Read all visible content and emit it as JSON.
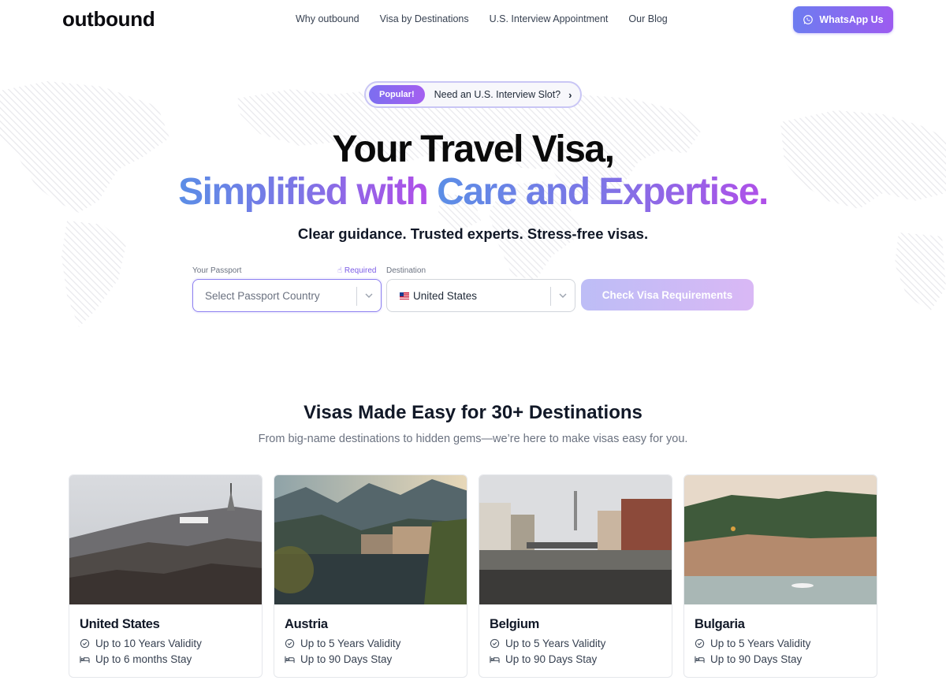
{
  "nav": {
    "logo": "outbound",
    "links": [
      "Why outbound",
      "Visa by Destinations",
      "U.S. Interview Appointment",
      "Our Blog"
    ],
    "whatsapp_label": "WhatsApp Us"
  },
  "hero": {
    "pill_badge": "Popular!",
    "pill_text": "Need an U.S. Interview Slot?",
    "headline_line1": "Your Travel Visa,",
    "headline_line2_a": "Simplified with",
    "headline_line2_b": "Care and Expertise.",
    "tagline": "Clear guidance. Trusted experts. Stress-free visas."
  },
  "form": {
    "passport_label": "Your Passport",
    "required_label": "Required",
    "passport_placeholder": "Select Passport Country",
    "destination_label": "Destination",
    "destination_value": "United States",
    "submit_label": "Check Visa Requirements"
  },
  "destinations": {
    "title": "Visas Made Easy for 30+ Destinations",
    "subtitle": "From big-name destinations to hidden gems—we’re here to make visas easy for you.",
    "cards": [
      {
        "name": "United States",
        "validity": "Up to 10 Years Validity",
        "stay": "Up to 6 months Stay"
      },
      {
        "name": "Austria",
        "validity": "Up to 5 Years Validity",
        "stay": "Up to 90 Days Stay"
      },
      {
        "name": "Belgium",
        "validity": "Up to 5 Years Validity",
        "stay": "Up to 90 Days Stay"
      },
      {
        "name": "Bulgaria",
        "validity": "Up to 5 Years Validity",
        "stay": "Up to 90 Days Stay"
      }
    ]
  },
  "colors": {
    "accent_start": "#5b8ee6",
    "accent_end": "#b04fe8",
    "whatsapp_gradient": [
      "#6d7cf0",
      "#9d5bf0"
    ]
  },
  "icons": {
    "whatsapp": "whatsapp-icon",
    "chevron": "chevron-right-icon",
    "dropdown": "chevron-down-icon",
    "required": "hand-pointer-icon",
    "validity": "check-circle-icon",
    "stay": "bed-icon"
  }
}
